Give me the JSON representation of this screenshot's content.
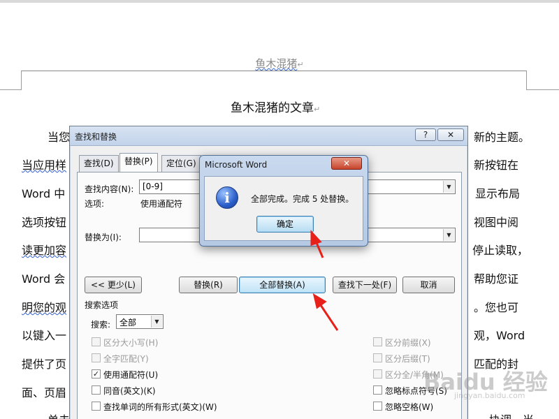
{
  "document": {
    "header_text": "鱼木混猪",
    "title": "鱼木混猪的文章",
    "visible_text": [
      "当您",
      "新的主题。",
      "当应用样",
      "新按钮在",
      "Word 中",
      "显示布局",
      "选项按钮",
      "视图中阅",
      "读更加容",
      "停止读取，",
      "Word 会",
      "帮助您证",
      "明您的观",
      "。您也可",
      "以键入一",
      "观，Word",
      "提供了页",
      "匹配的封",
      "面、页眉",
      "单击",
      "协调。当"
    ]
  },
  "find_replace": {
    "title": "查找和替换",
    "help_label": "?",
    "close_label": "✕",
    "tabs": [
      "查找(D)",
      "替换(P)",
      "定位(G)"
    ],
    "find_label": "查找内容(N):",
    "find_value": "[0-9]",
    "options_label": "选项:",
    "options_value": "使用通配符",
    "replace_label": "替换为(I):",
    "replace_value": "",
    "buttons": {
      "less": "<< 更少(L)",
      "replace": "替换(R)",
      "replace_all": "全部替换(A)",
      "find_next": "查找下一处(F)",
      "cancel": "取消"
    },
    "search_options_label": "搜索选项",
    "search_label": "搜索:",
    "search_value": "全部",
    "left_options": [
      {
        "label": "区分大小写(H)",
        "checked": false,
        "enabled": false
      },
      {
        "label": "全字匹配(Y)",
        "checked": false,
        "enabled": false
      },
      {
        "label": "使用通配符(U)",
        "checked": true,
        "enabled": true
      },
      {
        "label": "同音(英文)(K)",
        "checked": false,
        "enabled": true
      },
      {
        "label": "查找单词的所有形式(英文)(W)",
        "checked": false,
        "enabled": true
      }
    ],
    "right_options": [
      {
        "label": "区分前缀(X)",
        "checked": false,
        "enabled": false
      },
      {
        "label": "区分后缀(T)",
        "checked": false,
        "enabled": false
      },
      {
        "label": "区分全/半角(M)",
        "checked": false,
        "enabled": false
      },
      {
        "label": "忽略标点符号(S)",
        "checked": false,
        "enabled": true
      },
      {
        "label": "忽略空格(W)",
        "checked": false,
        "enabled": true
      }
    ]
  },
  "message_box": {
    "title": "Microsoft Word",
    "close_label": "✕",
    "message": "全部完成。完成 5 处替换。",
    "ok_label": "确定",
    "icon": "info-icon"
  },
  "watermark": {
    "brand": "Baidu 经验",
    "url": "jingyan.baidu.com"
  },
  "colors": {
    "dialog_bg": "#f0f0f0",
    "titlebar": "#c2d3ea",
    "close_red": "#c8442c",
    "arrow_red": "#e8201a",
    "focus_blue": "#3c7fb1"
  }
}
